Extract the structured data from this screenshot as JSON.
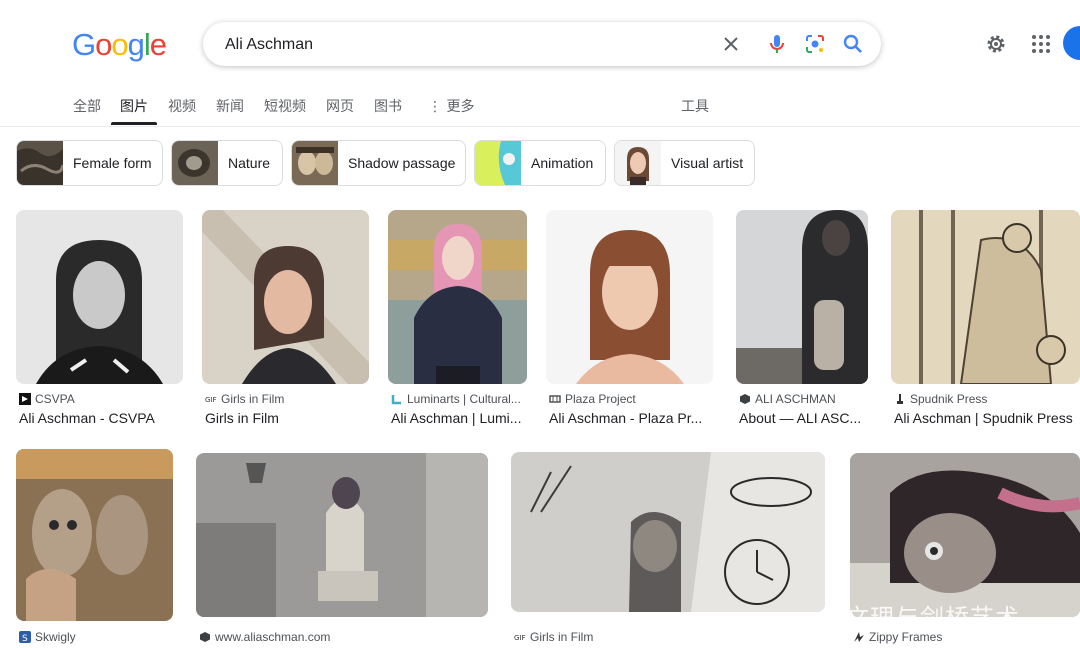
{
  "logo": {
    "letters": [
      "G",
      "o",
      "o",
      "g",
      "l",
      "e"
    ]
  },
  "search": {
    "query": "Ali Aschman"
  },
  "tabs": [
    "全部",
    "图片",
    "视频",
    "新闻",
    "短视频",
    "网页",
    "图书",
    "更多"
  ],
  "tools_label": "工具",
  "chips": [
    {
      "label": "Female form"
    },
    {
      "label": "Nature"
    },
    {
      "label": "Shadow passage"
    },
    {
      "label": "Animation"
    },
    {
      "label": "Visual artist"
    }
  ],
  "row1": [
    {
      "source": "CSVPA",
      "title": "Ali Aschman - CSVPA"
    },
    {
      "source": "Girls in Film",
      "title": "Girls in Film"
    },
    {
      "source": "Luminarts | Cultural...",
      "title": "Ali Aschman | Lumi..."
    },
    {
      "source": "Plaza Project",
      "title": "Ali Aschman - Plaza Pr..."
    },
    {
      "source": "ALI ASCHMAN",
      "title": "About — ALI ASC..."
    },
    {
      "source": "Spudnik Press",
      "title": "Ali Aschman | Spudnik Press"
    }
  ],
  "row2": [
    {
      "source": "Skwigly"
    },
    {
      "source": "www.aliaschman.com"
    },
    {
      "source": "Girls in Film"
    },
    {
      "source": "Zippy Frames"
    }
  ],
  "overlay_text": "桥文理与剑桥艺术",
  "colors": {
    "blue": "#4285f4",
    "red": "#ea4335",
    "yellow": "#fbbc05",
    "green": "#34a853",
    "accent": "#1a73e8"
  }
}
